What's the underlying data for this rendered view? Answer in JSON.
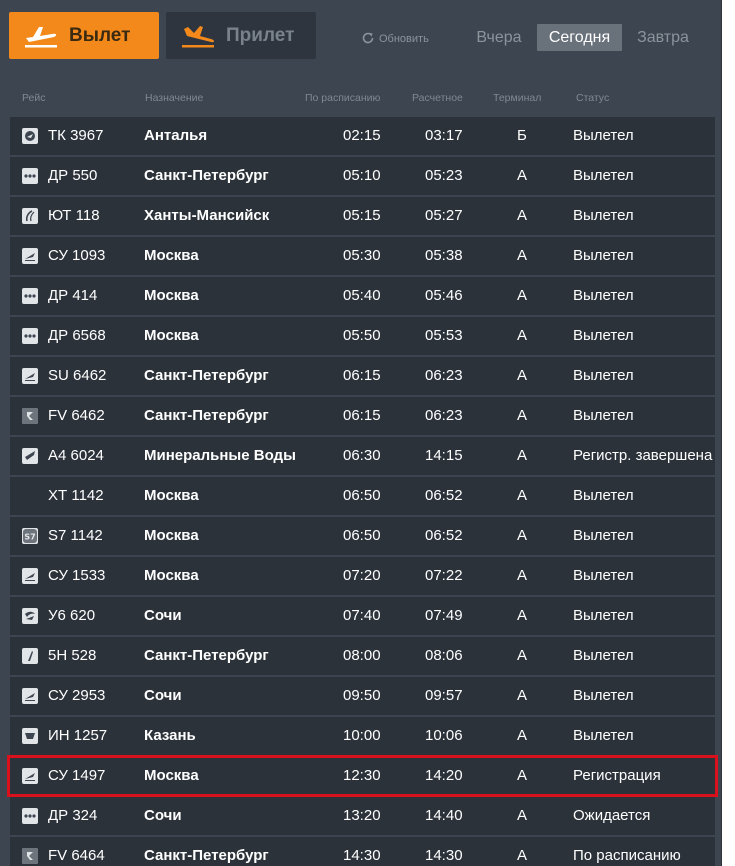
{
  "tabs": {
    "departure_label": "Вылет",
    "arrival_label": "Прилет",
    "refresh_label": "Обновить"
  },
  "days": {
    "yesterday": "Вчера",
    "today": "Сегодня",
    "tomorrow": "Завтра"
  },
  "columns": {
    "flight": "Рейс",
    "destination": "Назначение",
    "scheduled": "По расписанию",
    "estimated": "Расчетное",
    "terminal": "Терминал",
    "status": "Статус"
  },
  "colors": {
    "accent": "#f3891b",
    "board_bg": "#3d4650",
    "row_bg": "#2b323a",
    "highlight": "#d8111c"
  },
  "flights": [
    {
      "logo": "turkish-airlines-logo-icon",
      "flight": "ТК 3967",
      "destination": "Анталья",
      "scheduled": "02:15",
      "estimated": "03:17",
      "terminal": "Б",
      "status": "Вылетел"
    },
    {
      "logo": "dots-logo-icon",
      "flight": "ДР 550",
      "destination": "Санкт-Петербург",
      "scheduled": "05:10",
      "estimated": "05:23",
      "terminal": "А",
      "status": "Вылетел"
    },
    {
      "logo": "utair-logo-icon",
      "flight": "ЮТ 118",
      "destination": "Ханты-Мансийск",
      "scheduled": "05:15",
      "estimated": "05:27",
      "terminal": "А",
      "status": "Вылетел"
    },
    {
      "logo": "aeroflot-logo-icon",
      "flight": "СУ 1093",
      "destination": "Москва",
      "scheduled": "05:30",
      "estimated": "05:38",
      "terminal": "А",
      "status": "Вылетел"
    },
    {
      "logo": "dots-logo-icon",
      "flight": "ДР 414",
      "destination": "Москва",
      "scheduled": "05:40",
      "estimated": "05:46",
      "terminal": "А",
      "status": "Вылетел"
    },
    {
      "logo": "dots-logo-icon",
      "flight": "ДР 6568",
      "destination": "Москва",
      "scheduled": "05:50",
      "estimated": "05:53",
      "terminal": "А",
      "status": "Вылетел"
    },
    {
      "logo": "aeroflot-logo-icon",
      "flight": "SU 6462",
      "destination": "Санкт-Петербург",
      "scheduled": "06:15",
      "estimated": "06:23",
      "terminal": "А",
      "status": "Вылетел"
    },
    {
      "logo": "rossiya-logo-icon",
      "flight": "FV 6462",
      "destination": "Санкт-Петербург",
      "scheduled": "06:15",
      "estimated": "06:23",
      "terminal": "А",
      "status": "Вылетел"
    },
    {
      "logo": "wing-logo-icon",
      "flight": "А4 6024",
      "destination": "Минеральные Воды",
      "scheduled": "06:30",
      "estimated": "14:15",
      "terminal": "А",
      "status": "Регистр. завершена"
    },
    {
      "logo": "no-logo",
      "flight": "ХТ 1142",
      "destination": "Москва",
      "scheduled": "06:50",
      "estimated": "06:52",
      "terminal": "А",
      "status": "Вылетел"
    },
    {
      "logo": "s7-logo-icon",
      "flight": "S7 1142",
      "destination": "Москва",
      "scheduled": "06:50",
      "estimated": "06:52",
      "terminal": "А",
      "status": "Вылетел"
    },
    {
      "logo": "aeroflot-logo-icon",
      "flight": "СУ 1533",
      "destination": "Москва",
      "scheduled": "07:20",
      "estimated": "07:22",
      "terminal": "А",
      "status": "Вылетел"
    },
    {
      "logo": "ural-logo-icon",
      "flight": "У6 620",
      "destination": "Сочи",
      "scheduled": "07:40",
      "estimated": "07:49",
      "terminal": "А",
      "status": "Вылетел"
    },
    {
      "logo": "pobeda-logo-icon",
      "flight": "5Н 528",
      "destination": "Санкт-Петербург",
      "scheduled": "08:00",
      "estimated": "08:06",
      "terminal": "А",
      "status": "Вылетел"
    },
    {
      "logo": "aeroflot-logo-icon",
      "flight": "СУ 2953",
      "destination": "Сочи",
      "scheduled": "09:50",
      "estimated": "09:57",
      "terminal": "А",
      "status": "Вылетел"
    },
    {
      "logo": "izhavia-logo-icon",
      "flight": "ИН 1257",
      "destination": "Казань",
      "scheduled": "10:00",
      "estimated": "10:06",
      "terminal": "А",
      "status": "Вылетел"
    },
    {
      "logo": "aeroflot-logo-icon",
      "flight": "СУ 1497",
      "destination": "Москва",
      "scheduled": "12:30",
      "estimated": "14:20",
      "terminal": "А",
      "status": "Регистрация"
    },
    {
      "logo": "dots-logo-icon",
      "flight": "ДР 324",
      "destination": "Сочи",
      "scheduled": "13:20",
      "estimated": "14:40",
      "terminal": "А",
      "status": "Ожидается"
    },
    {
      "logo": "rossiya-logo-icon",
      "flight": "FV 6464",
      "destination": "Санкт-Петербург",
      "scheduled": "14:30",
      "estimated": "14:30",
      "terminal": "А",
      "status": "По расписанию"
    }
  ]
}
